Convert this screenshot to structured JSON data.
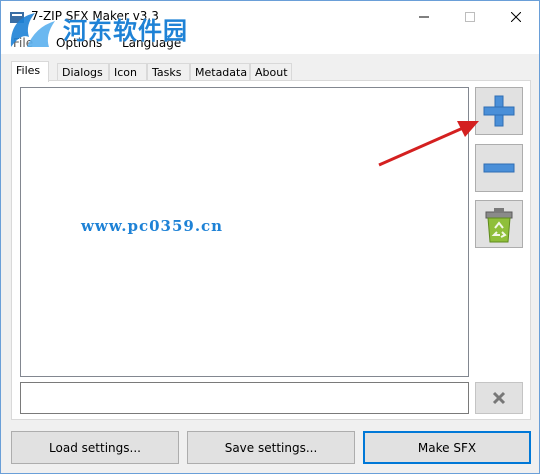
{
  "window": {
    "title": "7-ZIP SFX Maker v3.3"
  },
  "watermark": {
    "text": "河东软件园",
    "url": "www.pc0359.cn"
  },
  "menu": {
    "items": [
      "File",
      "Options",
      "Language"
    ]
  },
  "tabs": [
    "Files",
    "Dialogs",
    "Icon",
    "Tasks",
    "Metadata",
    "About"
  ],
  "active_tab": "Files",
  "side_buttons": {
    "add": "plus-icon",
    "remove": "minus-icon",
    "clear": "recycle-bin-icon"
  },
  "path_field": {
    "value": "",
    "placeholder": ""
  },
  "buttons": {
    "load": "Load settings...",
    "save": "Save settings...",
    "make": "Make SFX"
  },
  "colors": {
    "accent": "#0078d7",
    "icon_blue": "#4a8fd8",
    "annotation_arrow": "#d42020",
    "watermark": "#1e82d6"
  }
}
